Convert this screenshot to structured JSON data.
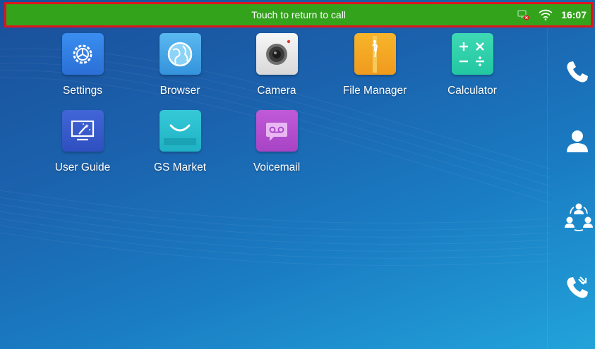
{
  "call_bar": {
    "text": "Touch to return to call",
    "border_color": "#e0141e",
    "background_color": "#33a31c"
  },
  "status_bar": {
    "time": "16:07",
    "icons": [
      "network-disconnected-icon",
      "wifi-icon"
    ]
  },
  "apps": [
    {
      "label": "Settings",
      "icon": "settings-icon"
    },
    {
      "label": "Browser",
      "icon": "browser-globe-icon"
    },
    {
      "label": "Camera",
      "icon": "camera-icon"
    },
    {
      "label": "File Manager",
      "icon": "file-manager-icon"
    },
    {
      "label": "Calculator",
      "icon": "calculator-icon"
    },
    {
      "label": "User Guide",
      "icon": "user-guide-icon"
    },
    {
      "label": "GS Market",
      "icon": "market-bag-icon"
    },
    {
      "label": "Voicemail",
      "icon": "voicemail-icon"
    }
  ],
  "dock": {
    "items": [
      "phone-icon",
      "contacts-icon",
      "conference-icon",
      "call-history-icon"
    ]
  }
}
